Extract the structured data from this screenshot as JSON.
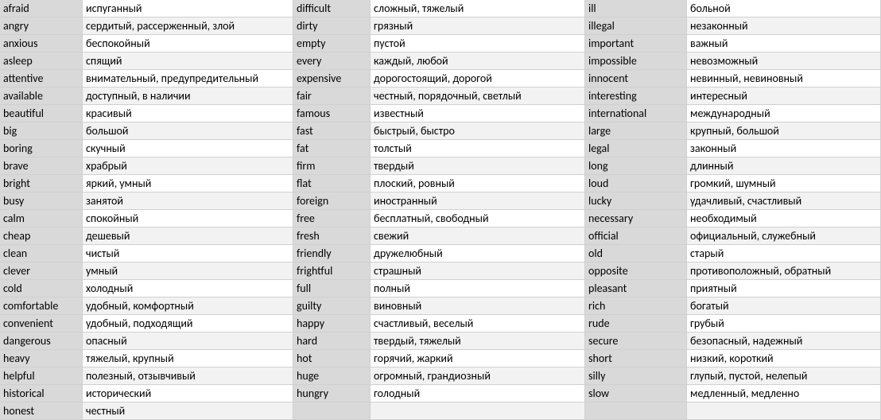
{
  "columns": [
    {
      "rows": [
        {
          "en": "afraid",
          "ru": "испуганный"
        },
        {
          "en": "angry",
          "ru": "сердитый, рассерженный, злой"
        },
        {
          "en": "anxious",
          "ru": "беспокойный"
        },
        {
          "en": "asleep",
          "ru": "спящий"
        },
        {
          "en": "attentive",
          "ru": "внимательный, предупредительный"
        },
        {
          "en": "available",
          "ru": "доступный, в наличии"
        },
        {
          "en": "beautiful",
          "ru": "красивый"
        },
        {
          "en": "big",
          "ru": "большой"
        },
        {
          "en": "boring",
          "ru": "скучный"
        },
        {
          "en": "brave",
          "ru": "храбрый"
        },
        {
          "en": "bright",
          "ru": "яркий, умный"
        },
        {
          "en": "busy",
          "ru": "занятой"
        },
        {
          "en": "calm",
          "ru": "спокойный"
        },
        {
          "en": "cheap",
          "ru": "дешевый"
        },
        {
          "en": "clean",
          "ru": "чистый"
        },
        {
          "en": "clever",
          "ru": "умный"
        },
        {
          "en": "cold",
          "ru": "холодный"
        },
        {
          "en": "comfortable",
          "ru": "удобный, комфортный"
        },
        {
          "en": "convenient",
          "ru": "удобный, подходящий"
        },
        {
          "en": "dangerous",
          "ru": "опасный"
        },
        {
          "en": "heavy",
          "ru": "тяжелый, крупный"
        },
        {
          "en": "helpful",
          "ru": "полезный, отзывчивый"
        },
        {
          "en": "historical",
          "ru": "исторический"
        },
        {
          "en": "honest",
          "ru": "честный"
        }
      ]
    },
    {
      "rows": [
        {
          "en": "difficult",
          "ru": "сложный, тяжелый"
        },
        {
          "en": "dirty",
          "ru": "грязный"
        },
        {
          "en": "empty",
          "ru": "пустой"
        },
        {
          "en": "every",
          "ru": "каждый, любой"
        },
        {
          "en": "expensive",
          "ru": "дорогостоящий, дорогой"
        },
        {
          "en": "fair",
          "ru": "честный, порядочный, светлый"
        },
        {
          "en": "famous",
          "ru": "известный"
        },
        {
          "en": "fast",
          "ru": "быстрый, быстро"
        },
        {
          "en": "fat",
          "ru": "толстый"
        },
        {
          "en": "firm",
          "ru": "твердый"
        },
        {
          "en": "flat",
          "ru": "плоский, ровный"
        },
        {
          "en": "foreign",
          "ru": "иностранный"
        },
        {
          "en": "free",
          "ru": "бесплатный, свободный"
        },
        {
          "en": "fresh",
          "ru": "свежий"
        },
        {
          "en": "friendly",
          "ru": "дружелюбный"
        },
        {
          "en": "frightful",
          "ru": "страшный"
        },
        {
          "en": "full",
          "ru": "полный"
        },
        {
          "en": "guilty",
          "ru": "виновный"
        },
        {
          "en": "happy",
          "ru": "счастливый, веселый"
        },
        {
          "en": "hard",
          "ru": "твердый, тяжелый"
        },
        {
          "en": "hot",
          "ru": "горячий, жаркий"
        },
        {
          "en": "huge",
          "ru": "огромный, грандиозный"
        },
        {
          "en": "hungry",
          "ru": "голодный"
        },
        {
          "en": "",
          "ru": ""
        }
      ]
    },
    {
      "rows": [
        {
          "en": "ill",
          "ru": "больной"
        },
        {
          "en": "illegal",
          "ru": "незаконный"
        },
        {
          "en": "important",
          "ru": "важный"
        },
        {
          "en": "impossible",
          "ru": "невозможный"
        },
        {
          "en": "innocent",
          "ru": "невинный, невиновный"
        },
        {
          "en": "interesting",
          "ru": "интересный"
        },
        {
          "en": "international",
          "ru": "международный"
        },
        {
          "en": "large",
          "ru": "крупный, большой"
        },
        {
          "en": "legal",
          "ru": "законный"
        },
        {
          "en": "long",
          "ru": "длинный"
        },
        {
          "en": "loud",
          "ru": "громкий, шумный"
        },
        {
          "en": "lucky",
          "ru": "удачливый, счастливый"
        },
        {
          "en": "necessary",
          "ru": "необходимый"
        },
        {
          "en": "official",
          "ru": "официальный, служебный"
        },
        {
          "en": "old",
          "ru": "старый"
        },
        {
          "en": "opposite",
          "ru": "противоположный, обратный"
        },
        {
          "en": "pleasant",
          "ru": "приятный"
        },
        {
          "en": "rich",
          "ru": "богатый"
        },
        {
          "en": "rude",
          "ru": "грубый"
        },
        {
          "en": "secure",
          "ru": "безопасный, надежный"
        },
        {
          "en": "short",
          "ru": "низкий, короткий"
        },
        {
          "en": "silly",
          "ru": "глупый, пустой, нелепый"
        },
        {
          "en": "slow",
          "ru": "медленный, медленно"
        },
        {
          "en": "",
          "ru": ""
        }
      ]
    }
  ]
}
